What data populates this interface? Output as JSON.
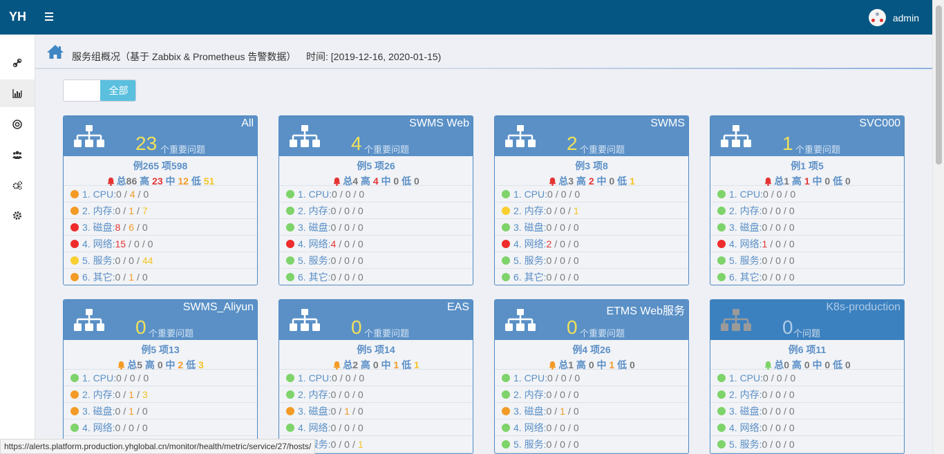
{
  "header": {
    "logo": "YH",
    "username": "admin"
  },
  "breadcrumb": {
    "title": "服务组概况（基于 Zabbix & Prometheus 告警数据）",
    "time": "时间: [2019-12-16, 2020-01-15)"
  },
  "filter": {
    "button_label": "全部"
  },
  "sidebar": [
    {
      "icon": "link-icon"
    },
    {
      "icon": "bar-chart-icon"
    },
    {
      "icon": "lifebuoy-icon"
    },
    {
      "icon": "users-icon"
    },
    {
      "icon": "gears-icon"
    },
    {
      "icon": "cog-icon"
    }
  ],
  "labels": {
    "instance": "例",
    "item": "项",
    "total": "总",
    "high": "高",
    "mid": "中",
    "low": "低"
  },
  "cards": [
    {
      "name": "All",
      "count": "23",
      "count_label": "个重要问题",
      "instances": "265",
      "items": "598",
      "total": "86",
      "high": "23",
      "mid": "12",
      "low": "51",
      "bell": "red",
      "rows": [
        {
          "label": "1. CPU:",
          "dot": "orange",
          "a": "0",
          "b": "4",
          "c": "0"
        },
        {
          "label": "2. 内存:",
          "dot": "orange",
          "a": "0",
          "b": "1",
          "c": "7"
        },
        {
          "label": "3. 磁盘:",
          "dot": "red",
          "a": "8",
          "b": "6",
          "c": "0"
        },
        {
          "label": "4. 网络:",
          "dot": "red",
          "a": "15",
          "b": "0",
          "c": "0"
        },
        {
          "label": "5. 服务:",
          "dot": "yellow",
          "a": "0",
          "b": "0",
          "c": "44"
        },
        {
          "label": "6. 其它:",
          "dot": "orange",
          "a": "0",
          "b": "1",
          "c": "0"
        }
      ]
    },
    {
      "name": "SWMS Web",
      "count": "4",
      "count_label": "个重要问题",
      "instances": "5",
      "items": "26",
      "total": "4",
      "high": "4",
      "mid": "0",
      "low": "0",
      "bell": "red",
      "rows": [
        {
          "label": "1. CPU:",
          "dot": "green",
          "a": "0",
          "b": "0",
          "c": "0"
        },
        {
          "label": "2. 内存:",
          "dot": "green",
          "a": "0",
          "b": "0",
          "c": "0"
        },
        {
          "label": "3. 磁盘:",
          "dot": "green",
          "a": "0",
          "b": "0",
          "c": "0"
        },
        {
          "label": "4. 网络:",
          "dot": "red",
          "a": "4",
          "b": "0",
          "c": "0"
        },
        {
          "label": "5. 服务:",
          "dot": "green",
          "a": "0",
          "b": "0",
          "c": "0"
        },
        {
          "label": "6. 其它:",
          "dot": "green",
          "a": "0",
          "b": "0",
          "c": "0"
        }
      ]
    },
    {
      "name": "SWMS",
      "count": "2",
      "count_label": "个重要问题",
      "instances": "3",
      "items": "8",
      "total": "3",
      "high": "2",
      "mid": "0",
      "low": "1",
      "bell": "red",
      "rows": [
        {
          "label": "1. CPU:",
          "dot": "green",
          "a": "0",
          "b": "0",
          "c": "0"
        },
        {
          "label": "2. 内存:",
          "dot": "yellow",
          "a": "0",
          "b": "0",
          "c": "1"
        },
        {
          "label": "3. 磁盘:",
          "dot": "green",
          "a": "0",
          "b": "0",
          "c": "0"
        },
        {
          "label": "4. 网络:",
          "dot": "red",
          "a": "2",
          "b": "0",
          "c": "0"
        },
        {
          "label": "5. 服务:",
          "dot": "green",
          "a": "0",
          "b": "0",
          "c": "0"
        },
        {
          "label": "6. 其它:",
          "dot": "green",
          "a": "0",
          "b": "0",
          "c": "0"
        }
      ]
    },
    {
      "name": "SVC000",
      "count": "1",
      "count_label": "个重要问题",
      "instances": "1",
      "items": "5",
      "total": "1",
      "high": "1",
      "mid": "0",
      "low": "0",
      "bell": "red",
      "rows": [
        {
          "label": "1. CPU:",
          "dot": "green",
          "a": "0",
          "b": "0",
          "c": "0"
        },
        {
          "label": "2. 内存:",
          "dot": "green",
          "a": "0",
          "b": "0",
          "c": "0"
        },
        {
          "label": "3. 磁盘:",
          "dot": "green",
          "a": "0",
          "b": "0",
          "c": "0"
        },
        {
          "label": "4. 网络:",
          "dot": "red",
          "a": "1",
          "b": "0",
          "c": "0"
        },
        {
          "label": "5. 服务:",
          "dot": "green",
          "a": "0",
          "b": "0",
          "c": "0"
        },
        {
          "label": "6. 其它:",
          "dot": "green",
          "a": "0",
          "b": "0",
          "c": "0"
        }
      ]
    },
    {
      "name": "SWMS_Aliyun",
      "count": "0",
      "count_label": "个重要问题",
      "instances": "5",
      "items": "13",
      "total": "5",
      "high": "0",
      "mid": "2",
      "low": "3",
      "bell": "orange",
      "rows": [
        {
          "label": "1. CPU:",
          "dot": "green",
          "a": "0",
          "b": "0",
          "c": "0"
        },
        {
          "label": "2. 内存:",
          "dot": "orange",
          "a": "0",
          "b": "1",
          "c": "3"
        },
        {
          "label": "3. 磁盘:",
          "dot": "orange",
          "a": "0",
          "b": "1",
          "c": "0"
        },
        {
          "label": "4. 网络:",
          "dot": "green",
          "a": "0",
          "b": "0",
          "c": "0"
        }
      ]
    },
    {
      "name": "EAS",
      "count": "0",
      "count_label": "个重要问题",
      "instances": "5",
      "items": "14",
      "total": "2",
      "high": "0",
      "mid": "1",
      "low": "1",
      "bell": "orange",
      "rows": [
        {
          "label": "1. CPU:",
          "dot": "green",
          "a": "0",
          "b": "0",
          "c": "0"
        },
        {
          "label": "2. 内存:",
          "dot": "green",
          "a": "0",
          "b": "0",
          "c": "0"
        },
        {
          "label": "3. 磁盘:",
          "dot": "orange",
          "a": "0",
          "b": "1",
          "c": "0"
        },
        {
          "label": "4. 网络:",
          "dot": "green",
          "a": "0",
          "b": "0",
          "c": "0"
        },
        {
          "label": "5. 服务:",
          "dot": "yellow",
          "a": "0",
          "b": "0",
          "c": "1"
        }
      ]
    },
    {
      "name": "ETMS Web服务",
      "count": "0",
      "count_label": "个重要问题",
      "instances": "4",
      "items": "26",
      "total": "1",
      "high": "0",
      "mid": "1",
      "low": "0",
      "bell": "orange",
      "rows": [
        {
          "label": "1. CPU:",
          "dot": "green",
          "a": "0",
          "b": "0",
          "c": "0"
        },
        {
          "label": "2. 内存:",
          "dot": "green",
          "a": "0",
          "b": "0",
          "c": "0"
        },
        {
          "label": "3. 磁盘:",
          "dot": "orange",
          "a": "0",
          "b": "1",
          "c": "0"
        },
        {
          "label": "4. 网络:",
          "dot": "green",
          "a": "0",
          "b": "0",
          "c": "0"
        },
        {
          "label": "5. 服务:",
          "dot": "green",
          "a": "0",
          "b": "0",
          "c": "0"
        }
      ]
    },
    {
      "name": "K8s-production",
      "count": "0",
      "count_label": "个问题",
      "instances": "6",
      "items": "11",
      "total": "0",
      "high": "0",
      "mid": "0",
      "low": "0",
      "bell": "green",
      "grey": true,
      "rows": [
        {
          "label": "1. CPU:",
          "dot": "green",
          "a": "0",
          "b": "0",
          "c": "0"
        },
        {
          "label": "2. 内存:",
          "dot": "green",
          "a": "0",
          "b": "0",
          "c": "0"
        },
        {
          "label": "3. 磁盘:",
          "dot": "green",
          "a": "0",
          "b": "0",
          "c": "0"
        },
        {
          "label": "4. 网络:",
          "dot": "green",
          "a": "0",
          "b": "0",
          "c": "0"
        },
        {
          "label": "5. 服务:",
          "dot": "green",
          "a": "0",
          "b": "0",
          "c": "0"
        }
      ]
    }
  ],
  "status_url": "https://alerts.platform.production.yhglobal.cn/monitor/health/metric/service/27/hosts/"
}
